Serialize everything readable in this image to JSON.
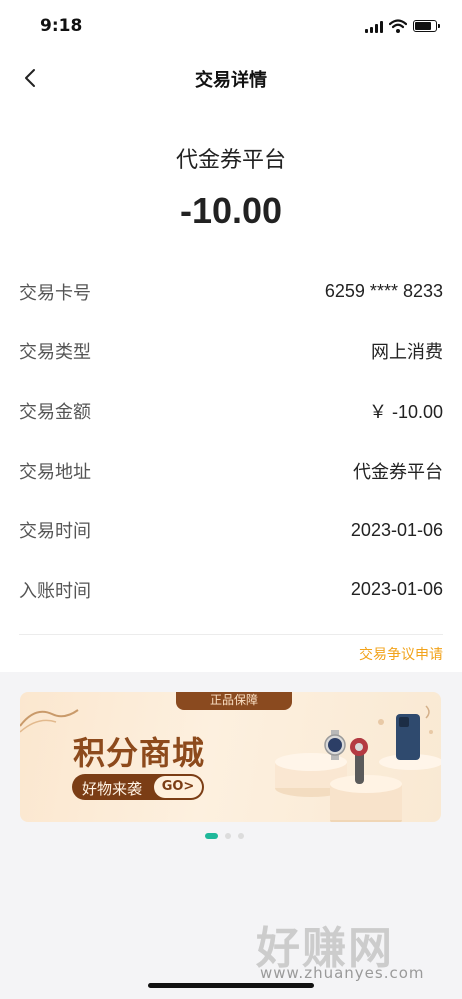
{
  "status_bar": {
    "time": "9:18",
    "icons": [
      "signal-icon",
      "wifi-icon",
      "battery-icon"
    ],
    "battery_level": 0.85
  },
  "nav": {
    "title": "交易详情",
    "back_icon": "chevron-left-icon"
  },
  "header": {
    "merchant": "代金券平台",
    "amount": "-10.00"
  },
  "details": [
    {
      "label": "交易卡号",
      "value": "6259 **** 8233"
    },
    {
      "label": "交易类型",
      "value": "网上消费"
    },
    {
      "label": "交易金额",
      "value": "￥ -10.00"
    },
    {
      "label": "交易地址",
      "value": "代金券平台"
    },
    {
      "label": "交易时间",
      "value": "2023-01-06"
    },
    {
      "label": "入账时间",
      "value": "2023-01-06"
    }
  ],
  "dispute_link": "交易争议申请",
  "banner": {
    "badge": "正品保障",
    "headline": "积分商城",
    "subtitle": "好物来袭",
    "cta": "GO>",
    "product_icons": [
      "watch-icon",
      "hair-dryer-icon",
      "smartphone-icon"
    ]
  },
  "carousel": {
    "count": 3,
    "active_index": 0
  },
  "watermark": {
    "brand": "好赚网",
    "url": "www.zhuanyes.com"
  },
  "colors": {
    "accent": "#f2a31b",
    "carousel_active": "#1fb89a",
    "banner_brown": "#8d4a1c",
    "background": "#f4f4f6"
  }
}
